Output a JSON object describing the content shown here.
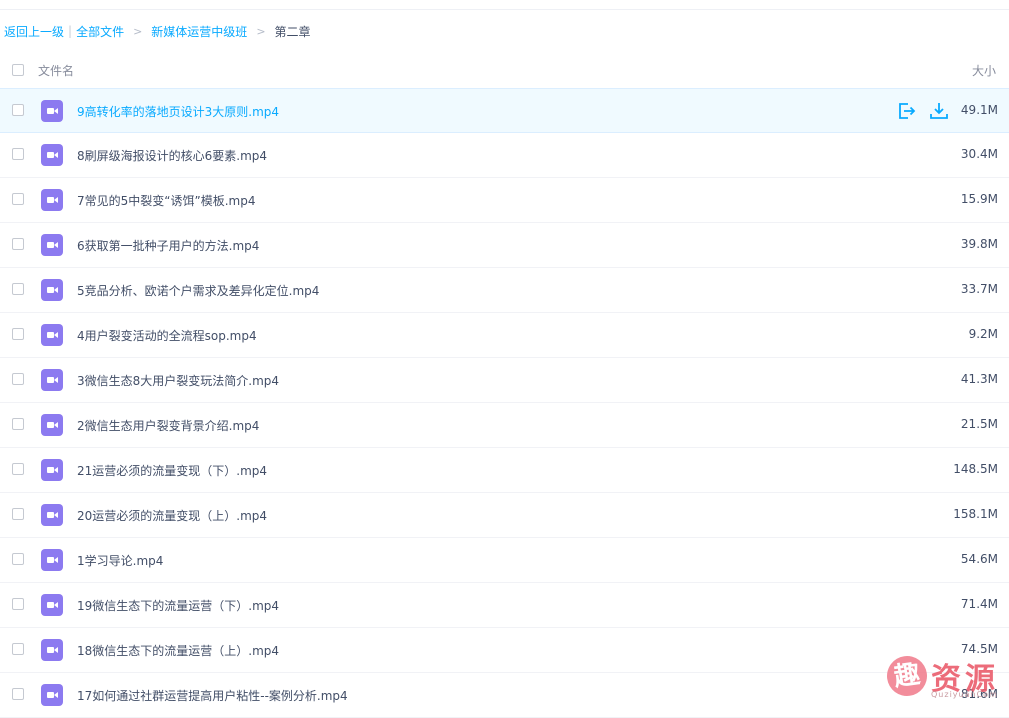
{
  "breadcrumb": {
    "back": "返回上一级",
    "all_files": "全部文件",
    "parent": "新媒体运营中级班",
    "current": "第二章",
    "sep_bar": "|",
    "sep": ">"
  },
  "table": {
    "col_name": "文件名",
    "col_size": "大小"
  },
  "icons": {
    "file": "video-file-icon",
    "share": "share-icon",
    "download": "download-icon"
  },
  "colors": {
    "accent": "#09aaff",
    "video_icon": "#8c7af0",
    "highlight_row": "#f0faff"
  },
  "files": [
    {
      "name": "9高转化率的落地页设计3大原则.mp4",
      "size": "49.1M",
      "highlighted": true
    },
    {
      "name": "8刷屏级海报设计的核心6要素.mp4",
      "size": "30.4M"
    },
    {
      "name": "7常见的5中裂变“诱饵”模板.mp4",
      "size": "15.9M"
    },
    {
      "name": "6获取第一批种子用户的方法.mp4",
      "size": "39.8M"
    },
    {
      "name": "5竞品分析、欧诺个户需求及差异化定位.mp4",
      "size": "33.7M"
    },
    {
      "name": "4用户裂变活动的全流程sop.mp4",
      "size": "9.2M"
    },
    {
      "name": "3微信生态8大用户裂变玩法简介.mp4",
      "size": "41.3M"
    },
    {
      "name": "2微信生态用户裂变背景介绍.mp4",
      "size": "21.5M"
    },
    {
      "name": "21运营必须的流量变现（下）.mp4",
      "size": "148.5M"
    },
    {
      "name": "20运营必须的流量变现（上）.mp4",
      "size": "158.1M"
    },
    {
      "name": "1学习导论.mp4",
      "size": "54.6M"
    },
    {
      "name": "19微信生态下的流量运营（下）.mp4",
      "size": "71.4M"
    },
    {
      "name": "18微信生态下的流量运营（上）.mp4",
      "size": "74.5M"
    },
    {
      "name": "17如何通过社群运营提高用户粘性--案例分析.mp4",
      "size": "81.6M"
    }
  ],
  "watermark": {
    "badge": "趣",
    "text": "资源",
    "sub": "QuziyuanCom"
  }
}
